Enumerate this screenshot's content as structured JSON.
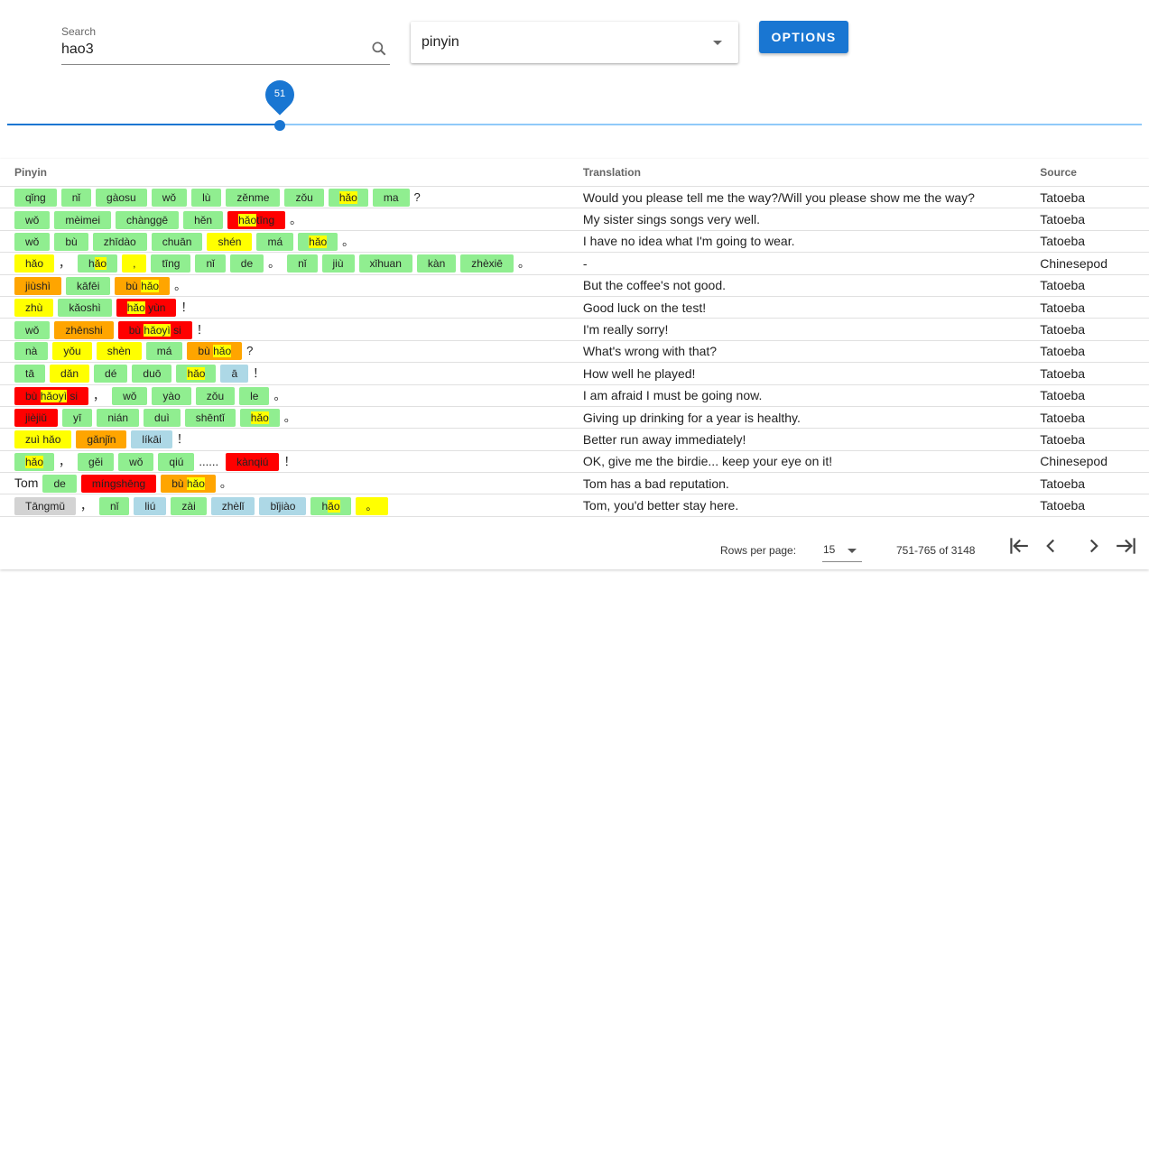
{
  "search": {
    "label": "Search",
    "value": "hao3"
  },
  "mode": {
    "value": "pinyin"
  },
  "options_label": "OPTIONS",
  "slider": {
    "value": "51",
    "level_fraction": 0.24
  },
  "table": {
    "headers": {
      "pinyin": "Pinyin",
      "translation": "Translation",
      "source": "Source"
    },
    "rows": [
      {
        "translation": "Would you please tell me the way?/Will you please show me the way?",
        "source": "Tatoeba"
      },
      {
        "translation": "My sister sings songs very well.",
        "source": "Tatoeba"
      },
      {
        "translation": "I have no idea what I'm going to wear.",
        "source": "Tatoeba"
      },
      {
        "translation": "-",
        "source": "Chinesepod"
      },
      {
        "translation": "But the coffee's not good.",
        "source": "Tatoeba"
      },
      {
        "translation": "Good luck on the test!",
        "source": "Tatoeba"
      },
      {
        "translation": "I'm really sorry!",
        "source": "Tatoeba"
      },
      {
        "translation": "What's wrong with that?",
        "source": "Tatoeba"
      },
      {
        "translation": "How well he played!",
        "source": "Tatoeba"
      },
      {
        "translation": "I am afraid I must be going now.",
        "source": "Tatoeba"
      },
      {
        "translation": "Giving up drinking for a year is healthy.",
        "source": "Tatoeba"
      },
      {
        "translation": "Better run away immediately!",
        "source": "Tatoeba"
      },
      {
        "translation": "OK, give me the birdie... keep your eye on it!",
        "source": "Chinesepod"
      },
      {
        "translation": "Tom has a bad reputation.",
        "source": "Tatoeba"
      },
      {
        "translation": "Tom, you'd better stay here.",
        "source": "Tatoeba"
      }
    ]
  },
  "pinyin_rows": [
    [
      [
        "g",
        "qǐng"
      ],
      [
        "g",
        "nǐ"
      ],
      [
        "g",
        "gàosu"
      ],
      [
        "g",
        "wǒ"
      ],
      [
        "g",
        "lù"
      ],
      [
        "g",
        "zěnme"
      ],
      [
        "g",
        "zǒu"
      ],
      [
        "g",
        "",
        "hǎo",
        ""
      ],
      [
        "g",
        "ma"
      ],
      [
        "p",
        "?"
      ]
    ],
    [
      [
        "g",
        "wǒ"
      ],
      [
        "g",
        "mèimei"
      ],
      [
        "g",
        "chànggē"
      ],
      [
        "g",
        "hěn"
      ],
      [
        "r",
        "",
        "hǎo",
        "tīng"
      ],
      [
        "p",
        "。"
      ]
    ],
    [
      [
        "g",
        "wǒ"
      ],
      [
        "g",
        "bù"
      ],
      [
        "g",
        "zhīdào"
      ],
      [
        "g",
        "chuān"
      ],
      [
        "y",
        "shén"
      ],
      [
        "g",
        "má"
      ],
      [
        "g",
        "",
        "hǎo",
        ""
      ],
      [
        "p",
        "。"
      ]
    ],
    [
      [
        "y",
        "",
        "hǎo",
        ""
      ],
      [
        "p",
        "，"
      ],
      [
        "g",
        "h",
        "ǎo",
        ""
      ],
      [
        "y",
        ","
      ],
      [
        "g",
        "tīng"
      ],
      [
        "g",
        "nǐ"
      ],
      [
        "g",
        "de"
      ],
      [
        "p",
        "。"
      ],
      [
        "g",
        "nǐ"
      ],
      [
        "g",
        "jiù"
      ],
      [
        "g",
        "xǐhuan"
      ],
      [
        "g",
        "kàn"
      ],
      [
        "g",
        "zhèxiē"
      ],
      [
        "p",
        "。"
      ]
    ],
    [
      [
        "o",
        "jiùshì"
      ],
      [
        "g",
        "kāfēi"
      ],
      [
        "o",
        "bù ",
        "hǎo",
        ""
      ],
      [
        "p",
        "。"
      ]
    ],
    [
      [
        "y",
        "zhù"
      ],
      [
        "g",
        "kǎoshì"
      ],
      [
        "r",
        "",
        "hǎo",
        " yùn"
      ],
      [
        "p",
        "！"
      ]
    ],
    [
      [
        "g",
        "wǒ"
      ],
      [
        "o",
        "zhēnshi"
      ],
      [
        "r",
        "bù ",
        "hǎoyì",
        " si"
      ],
      [
        "p",
        "！"
      ]
    ],
    [
      [
        "g",
        "nà"
      ],
      [
        "y",
        "yǒu"
      ],
      [
        "y",
        "shèn"
      ],
      [
        "g",
        "má"
      ],
      [
        "o",
        "bù ",
        "hǎo",
        ""
      ],
      [
        "p",
        "?"
      ]
    ],
    [
      [
        "g",
        "tā"
      ],
      [
        "y",
        "dǎn"
      ],
      [
        "g",
        "dé"
      ],
      [
        "g",
        "duō"
      ],
      [
        "g",
        "",
        "hǎo",
        ""
      ],
      [
        "b",
        "ā"
      ],
      [
        "p",
        "！"
      ]
    ],
    [
      [
        "r",
        "bù ",
        "hǎoyì",
        " si"
      ],
      [
        "p",
        "，"
      ],
      [
        "g",
        "wǒ"
      ],
      [
        "g",
        "yào"
      ],
      [
        "g",
        "zǒu"
      ],
      [
        "g",
        "le"
      ],
      [
        "p",
        "。"
      ]
    ],
    [
      [
        "r",
        "jièjiǔ"
      ],
      [
        "g",
        "yī"
      ],
      [
        "g",
        "nián"
      ],
      [
        "g",
        "duì"
      ],
      [
        "g",
        "shēntǐ"
      ],
      [
        "g",
        "",
        "hǎo",
        ""
      ],
      [
        "p",
        "。"
      ]
    ],
    [
      [
        "y",
        "zuì ",
        "hǎo",
        ""
      ],
      [
        "o",
        "gǎnjǐn"
      ],
      [
        "b",
        "líkāi"
      ],
      [
        "p",
        "！"
      ]
    ],
    [
      [
        "g",
        "",
        "hǎo",
        ""
      ],
      [
        "p",
        "，"
      ],
      [
        "g",
        "gěi"
      ],
      [
        "g",
        "wǒ"
      ],
      [
        "g",
        "qiú"
      ],
      [
        "p",
        "......"
      ],
      [
        "r",
        "kànqiú"
      ],
      [
        "p",
        "！"
      ]
    ],
    [
      [
        "t",
        "Tom"
      ],
      [
        "g",
        "de"
      ],
      [
        "r",
        "míngshēng"
      ],
      [
        "o",
        "bù ",
        "hǎo",
        ""
      ],
      [
        "p",
        "。"
      ]
    ],
    [
      [
        "gr",
        "Tāngmǔ"
      ],
      [
        "p",
        "，"
      ],
      [
        "g",
        "nǐ"
      ],
      [
        "b",
        "liú"
      ],
      [
        "g",
        "zài"
      ],
      [
        "b",
        "zhèlǐ"
      ],
      [
        "b",
        "bǐjiào"
      ],
      [
        "g",
        "h",
        "ǎo",
        ""
      ],
      [
        "y",
        "。"
      ]
    ]
  ],
  "pagination": {
    "rows_per_page_label": "Rows per page:",
    "rows_per_page_value": "15",
    "range_label": "751-765 of 3148"
  },
  "colors": {
    "accent": "#1976d2",
    "green": "#90ee90",
    "yellow": "#ffff00",
    "orange": "#ffa500",
    "red": "#ff0000",
    "blue": "#add8e6",
    "gray": "#d3d3d3"
  },
  "icons": {
    "search": "search-icon",
    "dropdown": "chevron-down-icon",
    "first": "first-page-icon",
    "prev": "chevron-left-icon",
    "next": "chevron-right-icon",
    "last": "last-page-icon"
  }
}
